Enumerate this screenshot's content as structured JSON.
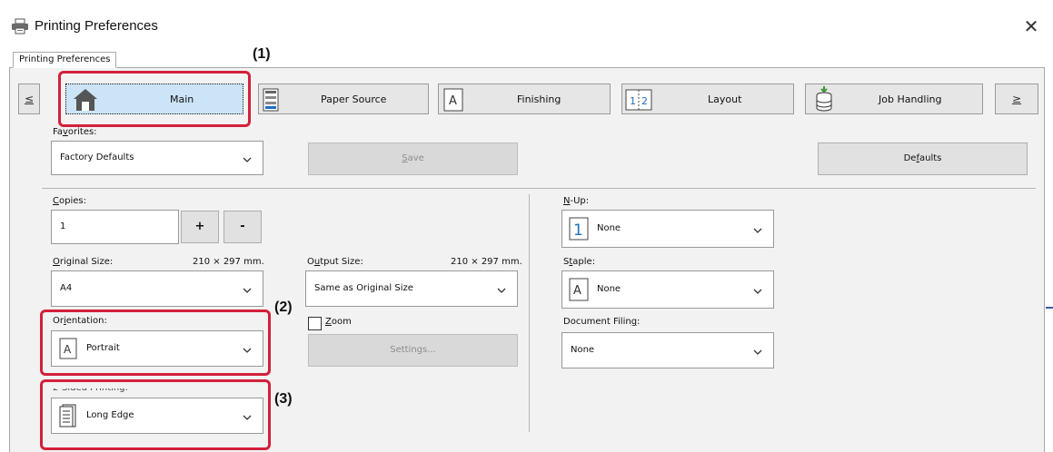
{
  "window": {
    "title": "Printing Preferences",
    "close_glyph": "✕",
    "printer_icon": "printer-icon"
  },
  "tab": {
    "label": "Printing Preferences"
  },
  "nav": {
    "prev": "≤",
    "next": "≥",
    "items": [
      {
        "label": "Main",
        "icon": "home-icon",
        "active": true
      },
      {
        "label": "Paper Source",
        "icon": "paper-tray-icon",
        "active": false
      },
      {
        "label": "Finishing",
        "icon": "finishing-icon",
        "active": false
      },
      {
        "label": "Layout",
        "icon": "layout-icon",
        "active": false
      },
      {
        "label": "Job Handling",
        "icon": "job-handling-icon",
        "active": false
      }
    ]
  },
  "favorites": {
    "label_pre": "Fa",
    "label_key": "v",
    "label_post": "orites:",
    "value": "Factory Defaults",
    "save_label_key": "S",
    "save_label_post": "ave",
    "defaults_pre": "De",
    "defaults_key": "f",
    "defaults_post": "aults"
  },
  "copies": {
    "label_key": "C",
    "label_post": "opies:",
    "value": "1",
    "plus": "+",
    "minus": "-"
  },
  "original_size": {
    "label_key": "O",
    "label_post": "riginal Size:",
    "dimensions": "210 × 297 mm.",
    "value": "A4"
  },
  "output_size": {
    "label_pre": "O",
    "label_key": "u",
    "label_post": "tput Size:",
    "dimensions": "210 × 297 mm.",
    "value": "Same as Original Size"
  },
  "orientation": {
    "label_pre": "Or",
    "label_key": "i",
    "label_post": "entation:",
    "value": "Portrait"
  },
  "zoom": {
    "label_key": "Z",
    "label_post": "oom",
    "checked": false,
    "settings_label": "Settings..."
  },
  "two_sided": {
    "label": "2-Sided Printing:",
    "value": "Long Edge"
  },
  "nup": {
    "label_key": "N",
    "label_post": "-Up:",
    "value": "None",
    "icon_text": "1"
  },
  "staple": {
    "label_pre": "S",
    "label_key": "t",
    "label_post": "aple:",
    "value": "None",
    "icon_text": "A"
  },
  "document_filing": {
    "label_pre": "Document Filin",
    "label_key": "g",
    "label_post": ":",
    "value": "None"
  },
  "callouts": {
    "c1": "(1)",
    "c2": "(2)",
    "c3": "(3)"
  },
  "colors": {
    "highlight": "#d2203a",
    "active_tab": "#cce4f7",
    "panel": "#f2f2f2",
    "accent": "#1e6fc0"
  }
}
